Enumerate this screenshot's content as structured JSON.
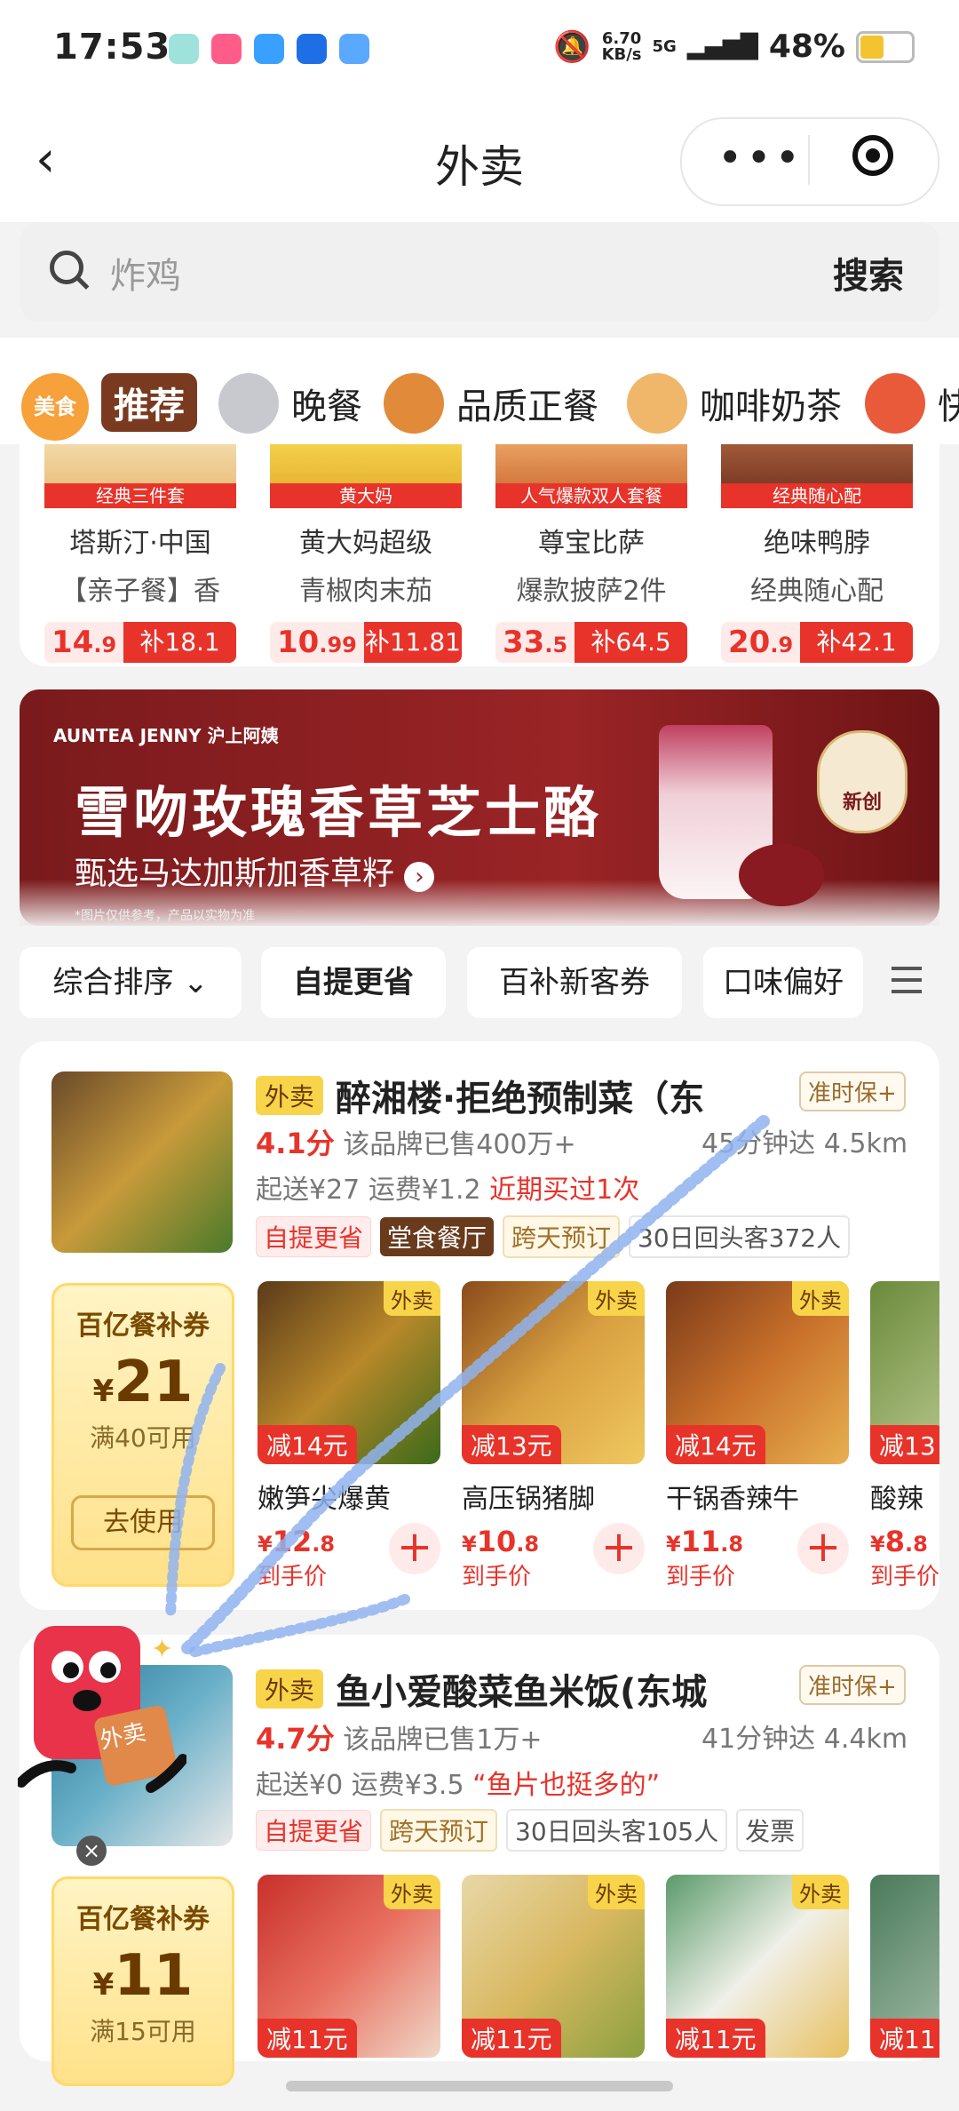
{
  "status_bar": {
    "time": "17:53",
    "network_speed": "6.70",
    "network_unit": "KB/s",
    "signal": "5G",
    "battery": "48%",
    "battery_level": 0.48
  },
  "nav": {
    "back_icon": "chevron-left-icon",
    "title": "外卖",
    "more_icon": "more-icon",
    "close_icon": "target-icon"
  },
  "search": {
    "placeholder": "炸鸡",
    "button": "搜索"
  },
  "categories": [
    {
      "label": "美食",
      "icon": "food-icon"
    },
    {
      "label": "推荐",
      "active": true
    },
    {
      "label": "晚餐",
      "icon": "dinner-icon"
    },
    {
      "label": "品质正餐",
      "icon": "meal-icon"
    },
    {
      "label": "咖啡奶茶",
      "icon": "coffee-icon"
    },
    {
      "label": "快",
      "icon": "fast-icon"
    }
  ],
  "top_products": [
    {
      "tag": "经典三件套",
      "name": "塔斯汀·中国",
      "desc": "【亲子餐】香",
      "price_main": "14",
      "price_dec": ".9",
      "subsidy": "补18.1"
    },
    {
      "tag": "黄大妈",
      "name": "黄大妈超级",
      "desc": "青椒肉末茄",
      "price_main": "10",
      "price_dec": ".99",
      "subsidy": "补11.81"
    },
    {
      "tag": "人气爆款双人套餐",
      "name": "尊宝比萨",
      "desc": "爆款披萨2件",
      "price_main": "33",
      "price_dec": ".5",
      "subsidy": "补64.5"
    },
    {
      "tag": "经典随心配",
      "name": "绝味鸭脖",
      "desc": "经典随心配",
      "price_main": "20",
      "price_dec": ".9",
      "subsidy": "补42.1"
    }
  ],
  "banner": {
    "brand": "AUNTEA JENNY 沪上阿姨",
    "title": "雪吻玫瑰香草芝士酪",
    "subtitle": "甄选马达加斯加香草籽",
    "note": "*图片仅供参考，产品以实物为准",
    "badge": "新创"
  },
  "filters": [
    {
      "label": "综合排序",
      "dropdown": "⌄"
    },
    {
      "label": "自提更省"
    },
    {
      "label": "百补新客券"
    },
    {
      "label": "口味偏好"
    }
  ],
  "stores": [
    {
      "badge": "外卖",
      "name": "醉湘楼·拒绝预制菜（东",
      "ontime": "准时保+",
      "score": "4.1分",
      "sales": "该品牌已售400万+",
      "eta": "45分钟达",
      "distance": "4.5km",
      "min_order": "起送¥27",
      "delivery_fee": "运费¥1.2",
      "highlight": "近期买过1次",
      "tags": [
        "自提更省",
        "堂食餐厅",
        "跨天预订",
        "30日回头客372人"
      ],
      "coupon": {
        "title": "百亿餐补券",
        "amount": "21",
        "currency": "¥",
        "condition": "满40可用",
        "button": "去使用"
      },
      "dishes": [
        {
          "name": "嫩笋尖爆黄",
          "off": "减14元",
          "price": "12",
          "dec": ".8",
          "sub": "到手价"
        },
        {
          "name": "高压锅猪脚",
          "off": "减13元",
          "price": "10",
          "dec": ".8",
          "sub": "到手价"
        },
        {
          "name": "干锅香辣牛",
          "off": "减14元",
          "price": "11",
          "dec": ".8",
          "sub": "到手价"
        },
        {
          "name": "酸辣",
          "off": "减13",
          "price": "8",
          "dec": ".8",
          "sub": "到手价"
        }
      ]
    },
    {
      "badge": "外卖",
      "name": "鱼小爱酸菜鱼米饭(东城",
      "ontime": "准时保+",
      "score": "4.7分",
      "sales": "该品牌已售1万+",
      "eta": "41分钟达",
      "distance": "4.4km",
      "min_order": "起送¥0",
      "delivery_fee": "运费¥3.5",
      "highlight": "“鱼片也挺多的”",
      "tags": [
        "自提更省",
        "跨天预订",
        "30日回头客105人",
        "发票"
      ],
      "coupon": {
        "title": "百亿餐补券",
        "amount": "11",
        "currency": "¥",
        "condition": "满15可用"
      },
      "dishes": [
        {
          "off": "减11元"
        },
        {
          "off": "减11元"
        },
        {
          "off": "减11元"
        },
        {
          "off": "减11"
        }
      ]
    }
  ],
  "dish_badge": "外卖",
  "mascot_label": "外卖",
  "colors": {
    "accent": "#e8332a",
    "coupon": "#ffe18a",
    "brand_brown": "#7a3a20"
  }
}
